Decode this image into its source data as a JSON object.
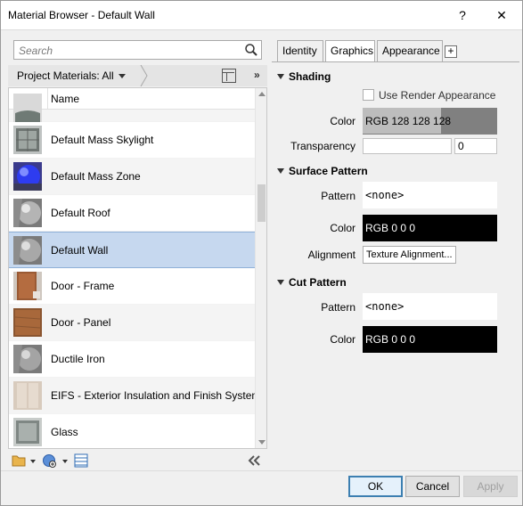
{
  "window": {
    "title": "Material Browser - Default Wall",
    "help_label": "?",
    "close_label": "✕"
  },
  "search": {
    "placeholder": "Search"
  },
  "library": {
    "label": "Project Materials: All",
    "more_label": "»"
  },
  "list": {
    "column_name": "Name",
    "items": [
      {
        "label": "",
        "thumb": "gray-tile",
        "partial": true
      },
      {
        "label": "Default Mass Skylight",
        "thumb": "glass-box"
      },
      {
        "label": "Default Mass Zone",
        "thumb": "blue-sphere"
      },
      {
        "label": "Default Roof",
        "thumb": "gray-sphere"
      },
      {
        "label": "Default Wall",
        "thumb": "gray-sphere",
        "selected": true
      },
      {
        "label": "Door - Frame",
        "thumb": "wood-frame"
      },
      {
        "label": "Door - Panel",
        "thumb": "wood-panel"
      },
      {
        "label": "Ductile Iron",
        "thumb": "gray-sphere"
      },
      {
        "label": "EIFS - Exterior Insulation and Finish System",
        "thumb": "beige-tile"
      },
      {
        "label": "Glass",
        "thumb": "gray-tile"
      }
    ]
  },
  "tabs": [
    {
      "label": "Identity"
    },
    {
      "label": "Graphics",
      "active": true
    },
    {
      "label": "Appearance"
    }
  ],
  "tab_add_label": "+",
  "shading": {
    "heading": "Shading",
    "use_render_label": "Use Render Appearance",
    "use_render_checked": false,
    "color_label": "Color",
    "color_value": "RGB 128 128 128",
    "transparency_label": "Transparency",
    "transparency_value": "0"
  },
  "surface_pattern": {
    "heading": "Surface Pattern",
    "pattern_label": "Pattern",
    "pattern_value": "<none>",
    "color_label": "Color",
    "color_value": "RGB 0 0 0",
    "alignment_label": "Alignment",
    "alignment_button": "Texture Alignment..."
  },
  "cut_pattern": {
    "heading": "Cut Pattern",
    "pattern_label": "Pattern",
    "pattern_value": "<none>",
    "color_label": "Color",
    "color_value": "RGB 0 0 0"
  },
  "buttons": {
    "ok": "OK",
    "cancel": "Cancel",
    "apply": "Apply"
  },
  "colors": {
    "selection": "#c6d8ef",
    "shading_color": "#808080",
    "pattern_color": "#000000",
    "ok_border": "#3c7fb1"
  }
}
